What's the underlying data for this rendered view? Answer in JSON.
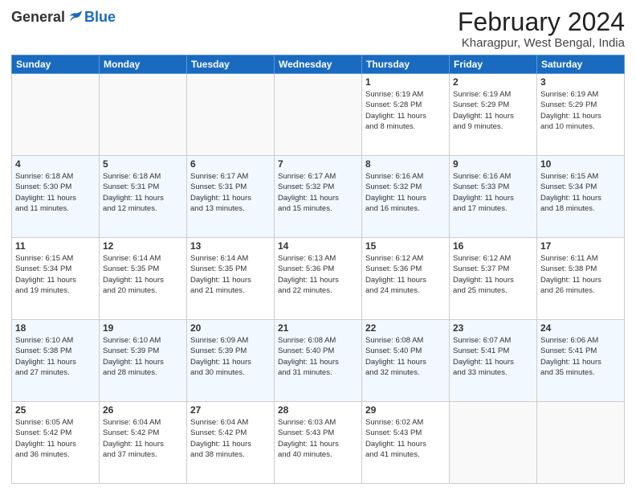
{
  "logo": {
    "general": "General",
    "blue": "Blue"
  },
  "title": "February 2024",
  "subtitle": "Kharagpur, West Bengal, India",
  "days_header": [
    "Sunday",
    "Monday",
    "Tuesday",
    "Wednesday",
    "Thursday",
    "Friday",
    "Saturday"
  ],
  "weeks": [
    [
      {
        "day": "",
        "info": ""
      },
      {
        "day": "",
        "info": ""
      },
      {
        "day": "",
        "info": ""
      },
      {
        "day": "",
        "info": ""
      },
      {
        "day": "1",
        "info": "Sunrise: 6:19 AM\nSunset: 5:28 PM\nDaylight: 11 hours\nand 8 minutes."
      },
      {
        "day": "2",
        "info": "Sunrise: 6:19 AM\nSunset: 5:29 PM\nDaylight: 11 hours\nand 9 minutes."
      },
      {
        "day": "3",
        "info": "Sunrise: 6:19 AM\nSunset: 5:29 PM\nDaylight: 11 hours\nand 10 minutes."
      }
    ],
    [
      {
        "day": "4",
        "info": "Sunrise: 6:18 AM\nSunset: 5:30 PM\nDaylight: 11 hours\nand 11 minutes."
      },
      {
        "day": "5",
        "info": "Sunrise: 6:18 AM\nSunset: 5:31 PM\nDaylight: 11 hours\nand 12 minutes."
      },
      {
        "day": "6",
        "info": "Sunrise: 6:17 AM\nSunset: 5:31 PM\nDaylight: 11 hours\nand 13 minutes."
      },
      {
        "day": "7",
        "info": "Sunrise: 6:17 AM\nSunset: 5:32 PM\nDaylight: 11 hours\nand 15 minutes."
      },
      {
        "day": "8",
        "info": "Sunrise: 6:16 AM\nSunset: 5:32 PM\nDaylight: 11 hours\nand 16 minutes."
      },
      {
        "day": "9",
        "info": "Sunrise: 6:16 AM\nSunset: 5:33 PM\nDaylight: 11 hours\nand 17 minutes."
      },
      {
        "day": "10",
        "info": "Sunrise: 6:15 AM\nSunset: 5:34 PM\nDaylight: 11 hours\nand 18 minutes."
      }
    ],
    [
      {
        "day": "11",
        "info": "Sunrise: 6:15 AM\nSunset: 5:34 PM\nDaylight: 11 hours\nand 19 minutes."
      },
      {
        "day": "12",
        "info": "Sunrise: 6:14 AM\nSunset: 5:35 PM\nDaylight: 11 hours\nand 20 minutes."
      },
      {
        "day": "13",
        "info": "Sunrise: 6:14 AM\nSunset: 5:35 PM\nDaylight: 11 hours\nand 21 minutes."
      },
      {
        "day": "14",
        "info": "Sunrise: 6:13 AM\nSunset: 5:36 PM\nDaylight: 11 hours\nand 22 minutes."
      },
      {
        "day": "15",
        "info": "Sunrise: 6:12 AM\nSunset: 5:36 PM\nDaylight: 11 hours\nand 24 minutes."
      },
      {
        "day": "16",
        "info": "Sunrise: 6:12 AM\nSunset: 5:37 PM\nDaylight: 11 hours\nand 25 minutes."
      },
      {
        "day": "17",
        "info": "Sunrise: 6:11 AM\nSunset: 5:38 PM\nDaylight: 11 hours\nand 26 minutes."
      }
    ],
    [
      {
        "day": "18",
        "info": "Sunrise: 6:10 AM\nSunset: 5:38 PM\nDaylight: 11 hours\nand 27 minutes."
      },
      {
        "day": "19",
        "info": "Sunrise: 6:10 AM\nSunset: 5:39 PM\nDaylight: 11 hours\nand 28 minutes."
      },
      {
        "day": "20",
        "info": "Sunrise: 6:09 AM\nSunset: 5:39 PM\nDaylight: 11 hours\nand 30 minutes."
      },
      {
        "day": "21",
        "info": "Sunrise: 6:08 AM\nSunset: 5:40 PM\nDaylight: 11 hours\nand 31 minutes."
      },
      {
        "day": "22",
        "info": "Sunrise: 6:08 AM\nSunset: 5:40 PM\nDaylight: 11 hours\nand 32 minutes."
      },
      {
        "day": "23",
        "info": "Sunrise: 6:07 AM\nSunset: 5:41 PM\nDaylight: 11 hours\nand 33 minutes."
      },
      {
        "day": "24",
        "info": "Sunrise: 6:06 AM\nSunset: 5:41 PM\nDaylight: 11 hours\nand 35 minutes."
      }
    ],
    [
      {
        "day": "25",
        "info": "Sunrise: 6:05 AM\nSunset: 5:42 PM\nDaylight: 11 hours\nand 36 minutes."
      },
      {
        "day": "26",
        "info": "Sunrise: 6:04 AM\nSunset: 5:42 PM\nDaylight: 11 hours\nand 37 minutes."
      },
      {
        "day": "27",
        "info": "Sunrise: 6:04 AM\nSunset: 5:42 PM\nDaylight: 11 hours\nand 38 minutes."
      },
      {
        "day": "28",
        "info": "Sunrise: 6:03 AM\nSunset: 5:43 PM\nDaylight: 11 hours\nand 40 minutes."
      },
      {
        "day": "29",
        "info": "Sunrise: 6:02 AM\nSunset: 5:43 PM\nDaylight: 11 hours\nand 41 minutes."
      },
      {
        "day": "",
        "info": ""
      },
      {
        "day": "",
        "info": ""
      }
    ]
  ]
}
